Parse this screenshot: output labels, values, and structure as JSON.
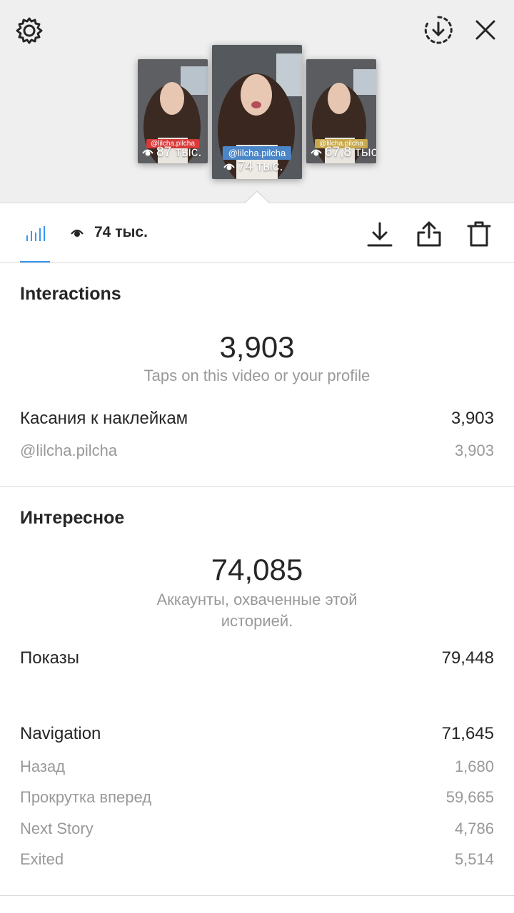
{
  "header": {
    "settings_icon": "gear-icon",
    "download_all_icon": "download-circle-icon",
    "close_icon": "close-icon"
  },
  "thumbnails": [
    {
      "tag": "@lilcha.pilcha",
      "views": "87 тыс.",
      "tag_color": "#d93a3a"
    },
    {
      "tag": "@lilcha.pilcha",
      "views": "74 тыс.",
      "tag_color": "#4a86c8"
    },
    {
      "tag": "@lilcha.pilcha",
      "views": "67,8 тыс.",
      "tag_color": "#c9a94b"
    }
  ],
  "toolbar": {
    "insights_icon": "bar-chart-icon",
    "views_icon": "eye-icon",
    "views": "74 тыс.",
    "download_icon": "download-icon",
    "share_icon": "share-icon",
    "delete_icon": "trash-icon"
  },
  "interactions": {
    "title": "Interactions",
    "total": "3,903",
    "caption": "Taps on this video or your profile",
    "rows": [
      {
        "label": "Касания к наклейкам",
        "value": "3,903"
      },
      {
        "label": "@lilcha.pilcha",
        "value": "3,903"
      }
    ]
  },
  "discovery": {
    "title": "Интересное",
    "total": "74,085",
    "caption": "Аккаунты, охваченные этой историей.",
    "impressions": {
      "label": "Показы",
      "value": "79,448"
    }
  },
  "navigation": {
    "label": "Navigation",
    "value": "71,645",
    "rows": [
      {
        "label": "Назад",
        "value": "1,680"
      },
      {
        "label": "Прокрутка вперед",
        "value": "59,665"
      },
      {
        "label": "Next Story",
        "value": "4,786"
      },
      {
        "label": "Exited",
        "value": "5,514"
      }
    ]
  },
  "colors": {
    "accent": "#3897f0",
    "text": "#262626",
    "muted": "#999999",
    "divider": "#dbdbdb"
  }
}
